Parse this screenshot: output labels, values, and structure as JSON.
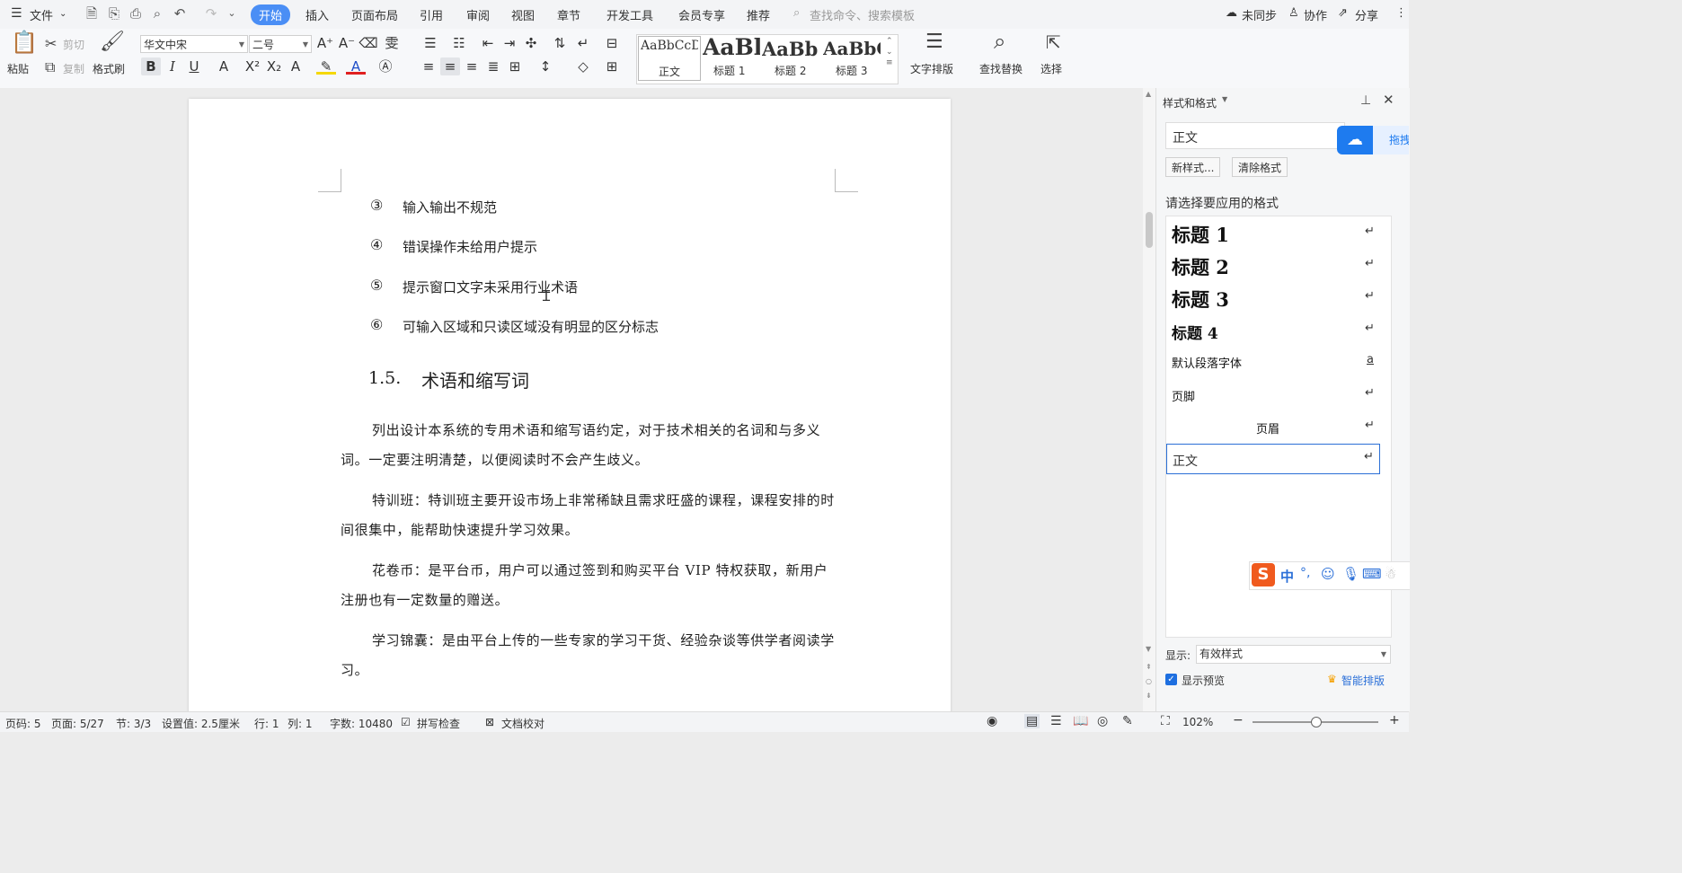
{
  "menubar": {
    "file": "文件",
    "tabs": [
      "开始",
      "插入",
      "页面布局",
      "引用",
      "审阅",
      "视图",
      "章节",
      "开发工具",
      "会员专享",
      "推荐"
    ],
    "search_placeholder": "查找命令、搜索模板",
    "sync": "未同步",
    "collab": "协作",
    "share": "分享"
  },
  "ribbon": {
    "paste": "粘贴",
    "cut": "剪切",
    "copy": "复制",
    "format_painter": "格式刷",
    "font_name": "华文中宋",
    "font_size": "二号",
    "styles": [
      {
        "preview": "AaBbCcDc",
        "name": "正文"
      },
      {
        "preview": "AaBl",
        "name": "标题 1"
      },
      {
        "preview": "AaBb(",
        "name": "标题 2"
      },
      {
        "preview": "AaBbC",
        "name": "标题 3"
      }
    ],
    "text_layout": "文字排版",
    "find_replace": "查找替换",
    "select": "选择"
  },
  "document": {
    "list_items": [
      {
        "num": "③",
        "text": "输入输出不规范"
      },
      {
        "num": "④",
        "text": "错误操作未给用户提示"
      },
      {
        "num": "⑤",
        "text": "提示窗口文字未采用行业术语"
      },
      {
        "num": "⑥",
        "text": "可输入区域和只读区域没有明显的区分标志"
      }
    ],
    "heading_num": "1.5.",
    "heading_text": "术语和缩写词",
    "paragraphs": [
      "列出设计本系统的专用术语和缩写语约定，对于技术相关的名词和与多义词。一定要注明清楚，以便阅读时不会产生歧义。",
      "特训班：特训班主要开设市场上非常稀缺且需求旺盛的课程，课程安排的时间很集中，能帮助快速提升学习效果。",
      "花卷币：是平台币，用户可以通过签到和购买平台 VIP 特权获取，新用户注册也有一定数量的赠送。",
      "学习锦囊：是由平台上传的一些专家的学习干货、经验杂谈等供学者阅读学习。"
    ]
  },
  "panel": {
    "title": "样式和格式",
    "current_style": "正文",
    "new_style": "新样式...",
    "clear_format": "清除格式",
    "choose_label": "请选择要应用的格式",
    "styles": [
      {
        "label": "标题  1",
        "mark": "↵"
      },
      {
        "label": "标题  2",
        "mark": "↵"
      },
      {
        "label": "标题  3",
        "mark": "↵"
      },
      {
        "label": "标题  4",
        "mark": "↵"
      },
      {
        "label": "默认段落字体",
        "mark": "a"
      },
      {
        "label": "页脚",
        "mark": "↵"
      },
      {
        "label": "页眉",
        "mark": "↵"
      },
      {
        "label": "正文",
        "mark": "↵"
      }
    ],
    "show_label": "显示:",
    "show_value": "有效样式",
    "show_preview": "显示预览",
    "smart_layout": "智能排版",
    "drag_badge": "拖拽"
  },
  "ime": {
    "lang": "中",
    "punct": "°,"
  },
  "status": {
    "page_code": "页码: 5",
    "page": "页面: 5/27",
    "section": "节: 3/3",
    "setting": "设置值: 2.5厘米",
    "row": "行: 1",
    "col": "列: 1",
    "words": "字数: 10480",
    "spell": "拼写检查",
    "proof": "文档校对",
    "zoom": "102%"
  },
  "colors": {
    "accent": "#4a8ef5",
    "panel_border": "#2b6fd6"
  }
}
